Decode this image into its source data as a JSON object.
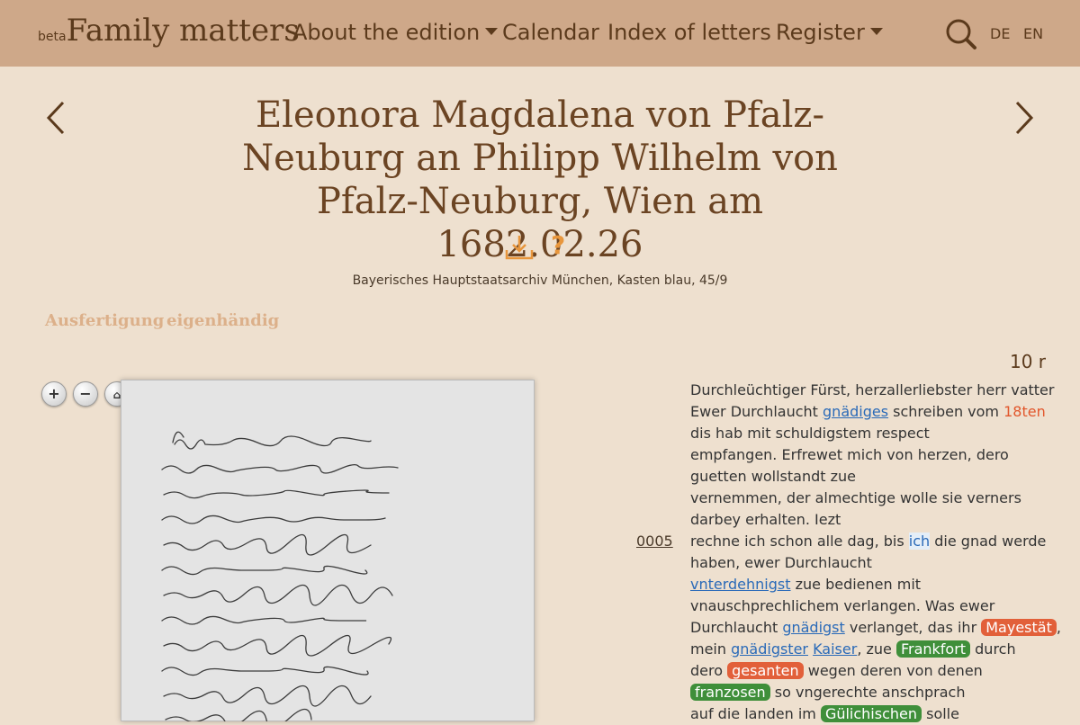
{
  "navbar": {
    "beta": "beta",
    "brand": "Family matters",
    "items": [
      {
        "label": "About the edition",
        "dropdown": true
      },
      {
        "label": "Calendar",
        "dropdown": false
      },
      {
        "label": "Index of letters",
        "dropdown": false
      },
      {
        "label": "Register",
        "dropdown": true
      }
    ],
    "languages": [
      "DE",
      "EN"
    ],
    "search_icon": "search-icon"
  },
  "letter": {
    "title_lines": [
      "Eleonora Magdalena von Pfalz-",
      "Neuburg an Philipp Wilhelm von",
      "Pfalz-Neuburg, Wien am 1682.02.26"
    ],
    "help": "?",
    "archive": "Bayerisches Hauptstaatsarchiv München, Kasten blau, 45/9",
    "tags": [
      "Ausfertigung",
      "eigenhändig"
    ],
    "folio": "10 r",
    "line_number": "0005"
  },
  "viewer": {
    "controls": [
      "zoom-in",
      "zoom-out",
      "home",
      "fullscreen",
      "rotate-left",
      "rotate-right"
    ]
  },
  "transcript": {
    "l1": "Durchleüchtiger Fürst, herzallerliebster herr vatter",
    "l2a": "Ewer Durchlaucht ",
    "l2b": "gnädiges",
    "l2c": " schreiben vom ",
    "l2d": "18ten",
    "l3": "dis hab mit schuldigstem respect",
    "l4": "empfangen. Erfrewet mich von herzen, dero",
    "l5": "guetten wollstandt zue",
    "l6": "vernemmen, der almechtige wolle sie verners",
    "l7": "darbey erhalten. Iezt",
    "l8a": "rechne ich schon alle dag, bis ",
    "l8b": "ich",
    "l8c": " die gnad werde",
    "l9": "haben, ewer Durchlaucht",
    "l10a": "vnterdehnigst",
    "l10b": " zue bedienen mit",
    "l11": "vnauschprechlichem verlangen. Was ewer",
    "l12a": "Durchlaucht ",
    "l12b": "gnädigst",
    "l12c": " verlanget, das ihr ",
    "l12d": "Mayestät",
    "l12e": ",",
    "l13a": "mein ",
    "l13b": "gnädigster",
    "l13c": " ",
    "l13d": "Kaiser",
    "l13e": ", zue ",
    "l13f": "Frankfort",
    "l13g": " durch",
    "l14a": "dero ",
    "l14b": "gesanten",
    "l14c": " wegen deren von denen",
    "l15a": "franzosen",
    "l15b": " so vngerechte anschprach",
    "l16a": "auf die landen im ",
    "l16b": "Gülichischen",
    "l16c": " solle"
  }
}
